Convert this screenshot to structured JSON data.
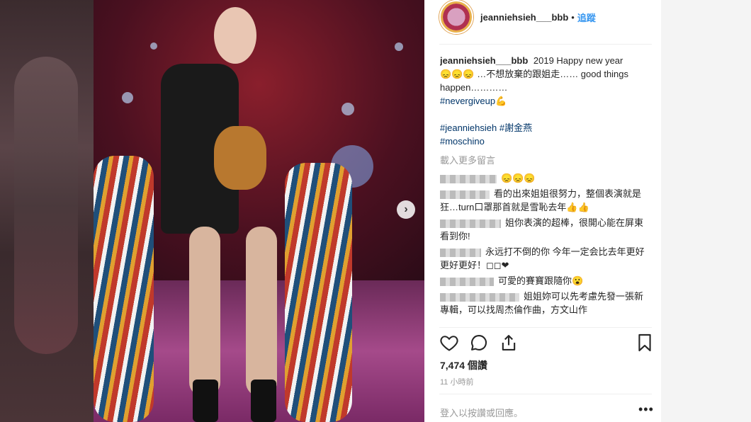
{
  "post": {
    "username": "jeanniehsieh___bbb",
    "separator": "•",
    "follow_label": "追蹤",
    "caption_user": "jeanniehsieh___bbb",
    "caption_text_1": "2019 Happy new year",
    "caption_text_2": "…不想放棄的跟姐走…… good things happen…………",
    "caption_emoji_1": "😞😞😞",
    "caption_emoji_2": "💪",
    "hashtag_1": "#nevergiveup",
    "hashtag_2": "#jeanniehsieh",
    "hashtag_3": "#謝金燕",
    "hashtag_4": "#moschino",
    "load_more": "載入更多留言"
  },
  "comments": [
    {
      "text": "😞😞😞"
    },
    {
      "text": "看的出來姐姐很努力，整個表演就是狂…turn口罩那首就是雪恥去年👍👍"
    },
    {
      "text": "姐你表演的超棒，很開心能在屏東看到你!"
    },
    {
      "text": "永远打不倒的你 今年一定会比去年更好更好更好！◻◻❤"
    },
    {
      "text": "可愛的賽寶跟隨你😮"
    },
    {
      "text": "姐姐妳可以先考慮先發一張新專輯，可以找周杰倫作曲，方文山作"
    }
  ],
  "stats": {
    "likes": "7,474 個讚",
    "time_ago": "11 小時前"
  },
  "input": {
    "placeholder": "登入以按讚或回應。"
  },
  "controls": {
    "next_glyph": "›",
    "more_glyph": "•••"
  }
}
